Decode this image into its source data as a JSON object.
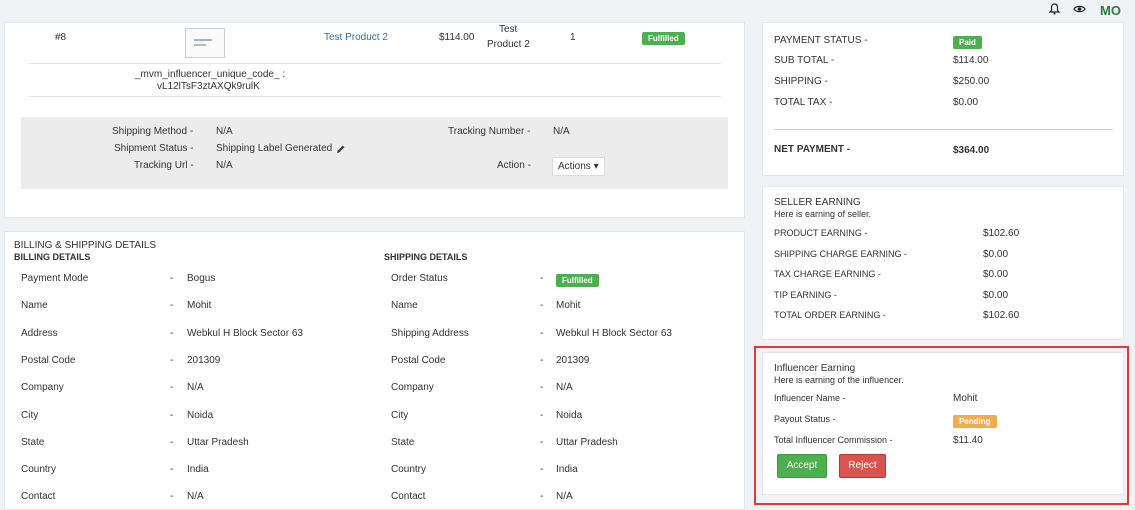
{
  "topbar": {
    "avatar_initials": "MO",
    "icons": [
      "bell-icon",
      "eye-icon"
    ]
  },
  "order_item": {
    "id": "#8",
    "product_name": "Test Product 2",
    "price": "$114.00",
    "sku_line1": "Test",
    "sku_line2": "Product 2",
    "quantity": "1",
    "status": "Fulfilled",
    "meta_key": "_mvm_influencer_unique_code_ :",
    "meta_value": "vL12lTsF3ztAXQk9rulK"
  },
  "shipping_box": {
    "shipping_method_label": "Shipping Method -",
    "shipping_method_value": "N/A",
    "shipment_status_label": "Shipment Status -",
    "shipment_status_value": "Shipping Label Generated",
    "tracking_url_label": "Tracking Url -",
    "tracking_url_value": "N/A",
    "tracking_number_label": "Tracking Number -",
    "tracking_number_value": "N/A",
    "action_label": "Action -",
    "actions_button": "Actions ▾"
  },
  "billing": {
    "section_title": "BILLING & SHIPPING DETAILS",
    "billing_title": "BILLING DETAILS",
    "shipping_title": "SHIPPING DETAILS",
    "dash": "-",
    "billing_rows": [
      {
        "label": "Payment Mode",
        "value": "Bogus"
      },
      {
        "label": "Name",
        "value": "Mohit"
      },
      {
        "label": "Address",
        "value": "Webkul H Block Sector 63"
      },
      {
        "label": "Postal Code",
        "value": "201309"
      },
      {
        "label": "Company",
        "value": "N/A"
      },
      {
        "label": "City",
        "value": "Noida"
      },
      {
        "label": "State",
        "value": "Uttar Pradesh"
      },
      {
        "label": "Country",
        "value": "India"
      },
      {
        "label": "Contact",
        "value": "N/A"
      }
    ],
    "shipping_rows": [
      {
        "label": "Order Status",
        "value": "Fulfilled"
      },
      {
        "label": "Name",
        "value": "Mohit"
      },
      {
        "label": "Shipping Address",
        "value": "Webkul H Block Sector 63"
      },
      {
        "label": "Postal Code",
        "value": "201309"
      },
      {
        "label": "Company",
        "value": "N/A"
      },
      {
        "label": "City",
        "value": "Noida"
      },
      {
        "label": "State",
        "value": "Uttar Pradesh"
      },
      {
        "label": "Country",
        "value": "India"
      },
      {
        "label": "Contact",
        "value": "N/A"
      }
    ]
  },
  "payment": {
    "payment_status_label": "PAYMENT STATUS -",
    "payment_status_value": "Paid",
    "sub_total_label": "SUB TOTAL -",
    "sub_total_value": "$114.00",
    "shipping_label": "SHIPPING -",
    "shipping_value": "$250.00",
    "total_tax_label": "TOTAL TAX -",
    "total_tax_value": "$0.00",
    "net_payment_label": "NET PAYMENT -",
    "net_payment_value": "$364.00"
  },
  "seller": {
    "title": "SELLER EARNING",
    "subtitle": "Here is earning of seller.",
    "rows": [
      {
        "label": "PRODUCT EARNING -",
        "value": "$102.60"
      },
      {
        "label": "SHIPPING CHARGE EARNING -",
        "value": "$0.00"
      },
      {
        "label": "TAX CHARGE EARNING -",
        "value": "$0.00"
      },
      {
        "label": "TIP EARNING -",
        "value": "$0.00"
      },
      {
        "label": "TOTAL ORDER EARNING -",
        "value": "$102.60"
      }
    ]
  },
  "influencer": {
    "title": "Influencer Earning",
    "subtitle": "Here is earning of the influencer.",
    "name_label": "Influencer Name -",
    "name_value": "Mohit",
    "payout_label": "Payout Status -",
    "payout_value": "Pending",
    "commission_label": "Total Influencer Commission -",
    "commission_value": "$11.40",
    "accept_label": "Accept",
    "reject_label": "Reject"
  },
  "colors": {
    "accent_green": "#4caf50",
    "accent_red": "#d9534f",
    "link_blue": "#2a6fb5",
    "pending_orange": "#f0ad4e",
    "highlight_frame": "#e53935"
  }
}
